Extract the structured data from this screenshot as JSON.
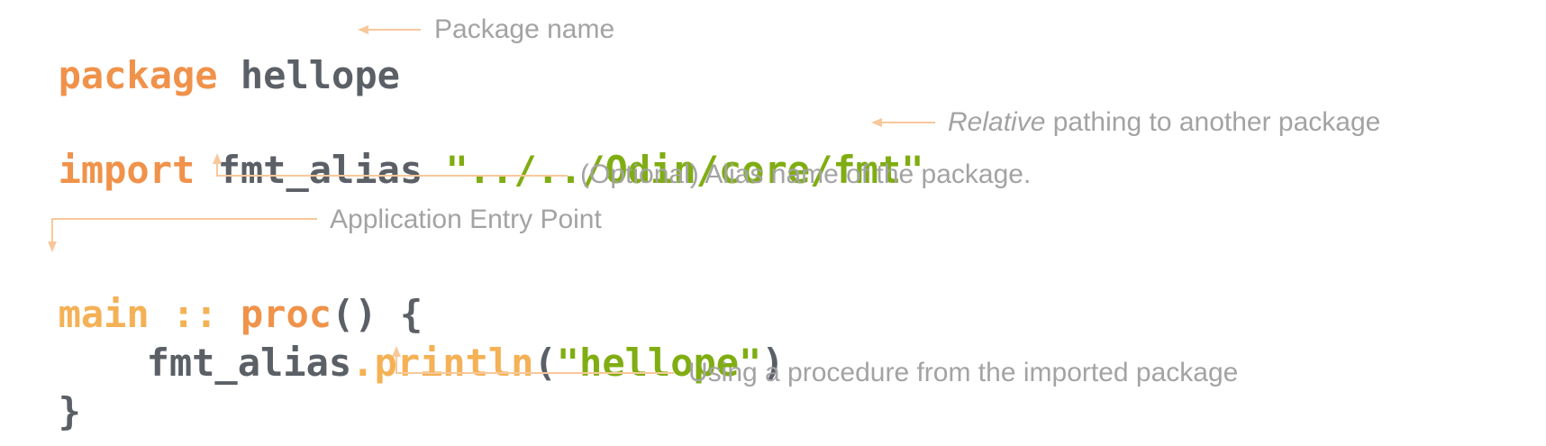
{
  "code": {
    "line1": {
      "kw": "package",
      "name": "hellope"
    },
    "line2": {
      "kw": "import",
      "alias": "fmt_alias",
      "path": "\"../../Odin/core/fmt\""
    },
    "line3": {
      "name": "main",
      "sep": " :: ",
      "kw": "proc",
      "rest": "() {"
    },
    "line4": {
      "obj": "fmt_alias",
      "dot": ".",
      "fn": "println",
      "open": "(",
      "arg": "\"hellope\"",
      "close": ")"
    },
    "line5": {
      "brace": "}"
    }
  },
  "annotations": {
    "package_name": "Package name",
    "relative_italic": "Relative",
    "relative_rest": " pathing to another package",
    "alias": "(Optional) Alias name of the package.",
    "entry_point": "Application Entry Point",
    "procedure": "Using a procedure from the imported package"
  },
  "colors": {
    "keyword": "#f0924a",
    "identifier": "#5b5f66",
    "string": "#80ad12",
    "function": "#f4b155",
    "annotation": "#a3a3a3",
    "arrow": "#f8c89a"
  }
}
